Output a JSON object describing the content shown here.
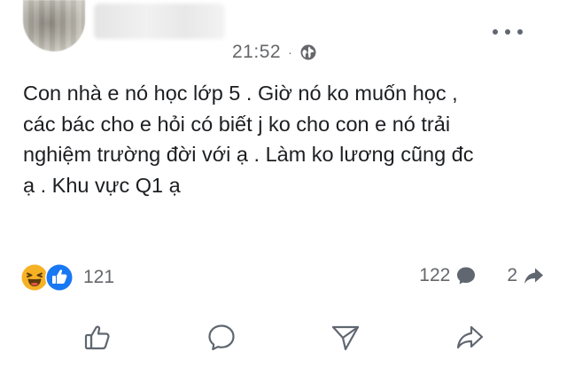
{
  "post": {
    "time": "21:52",
    "separator": "·",
    "privacy_icon": "globe-icon",
    "text": "Con nhà e nó học lớp 5 . Giờ nó ko muốn học ,\ncác bác cho e hỏi có biết j ko cho con e nó trải\nnghiệm trường đời với ạ . Làm ko lương cũng đc\nạ . Khu vực Q1 ạ"
  },
  "reactions": {
    "icons": [
      "haha-icon",
      "like-reaction-icon"
    ],
    "count": "121"
  },
  "stats": {
    "comments": "122",
    "shares": "2"
  },
  "actions": [
    {
      "icon": "thumbs-up-icon",
      "name": "like"
    },
    {
      "icon": "comment-icon",
      "name": "comment"
    },
    {
      "icon": "send-icon",
      "name": "send"
    },
    {
      "icon": "share-icon",
      "name": "share"
    }
  ],
  "colors": {
    "text": "#1c1e21",
    "secondary": "#65676b",
    "like_blue": "#1877f2",
    "haha_yellow": "#f7b125"
  }
}
